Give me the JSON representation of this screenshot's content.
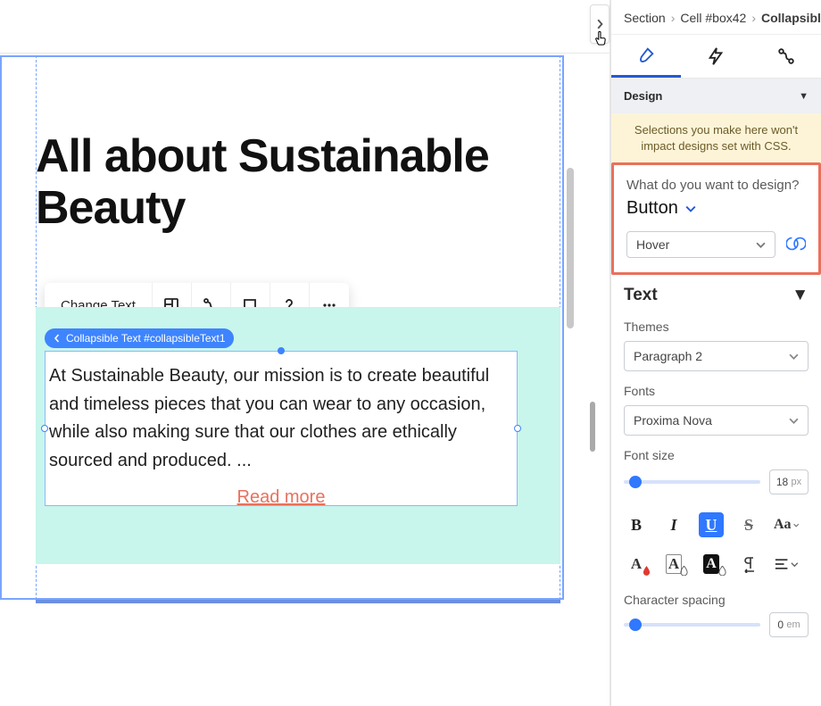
{
  "canvas": {
    "page_title": "All about Sustainable Beauty",
    "toolbar": {
      "change_text": "Change Text"
    },
    "tag_label": "Collapsible Text #collapsibleText1",
    "body_text": "At Sustainable Beauty, our mission is to create beautiful and timeless pieces that you can wear to any occasion, while also making sure that our clothes are ethically sourced and produced. ...",
    "read_more": "Read more"
  },
  "panel": {
    "breadcrumb": {
      "a": "Section",
      "b": "Cell #box42",
      "c": "Collapsible"
    },
    "design_header": "Design",
    "warning": "Selections you make here won't impact designs set with CSS.",
    "question": "What do you want to design?",
    "target": "Button",
    "state": "Hover",
    "text_header": "Text",
    "themes_label": "Themes",
    "themes_value": "Paragraph 2",
    "fonts_label": "Fonts",
    "fonts_value": "Proxima Nova",
    "fontsize_label": "Font size",
    "fontsize_value": "18",
    "fontsize_unit": "px",
    "char_label": "Character spacing",
    "char_value": "0",
    "char_unit": "em",
    "fmt": {
      "b": "B",
      "i": "I",
      "u": "U",
      "s": "S",
      "aa": "Aa",
      "A": "A"
    }
  }
}
